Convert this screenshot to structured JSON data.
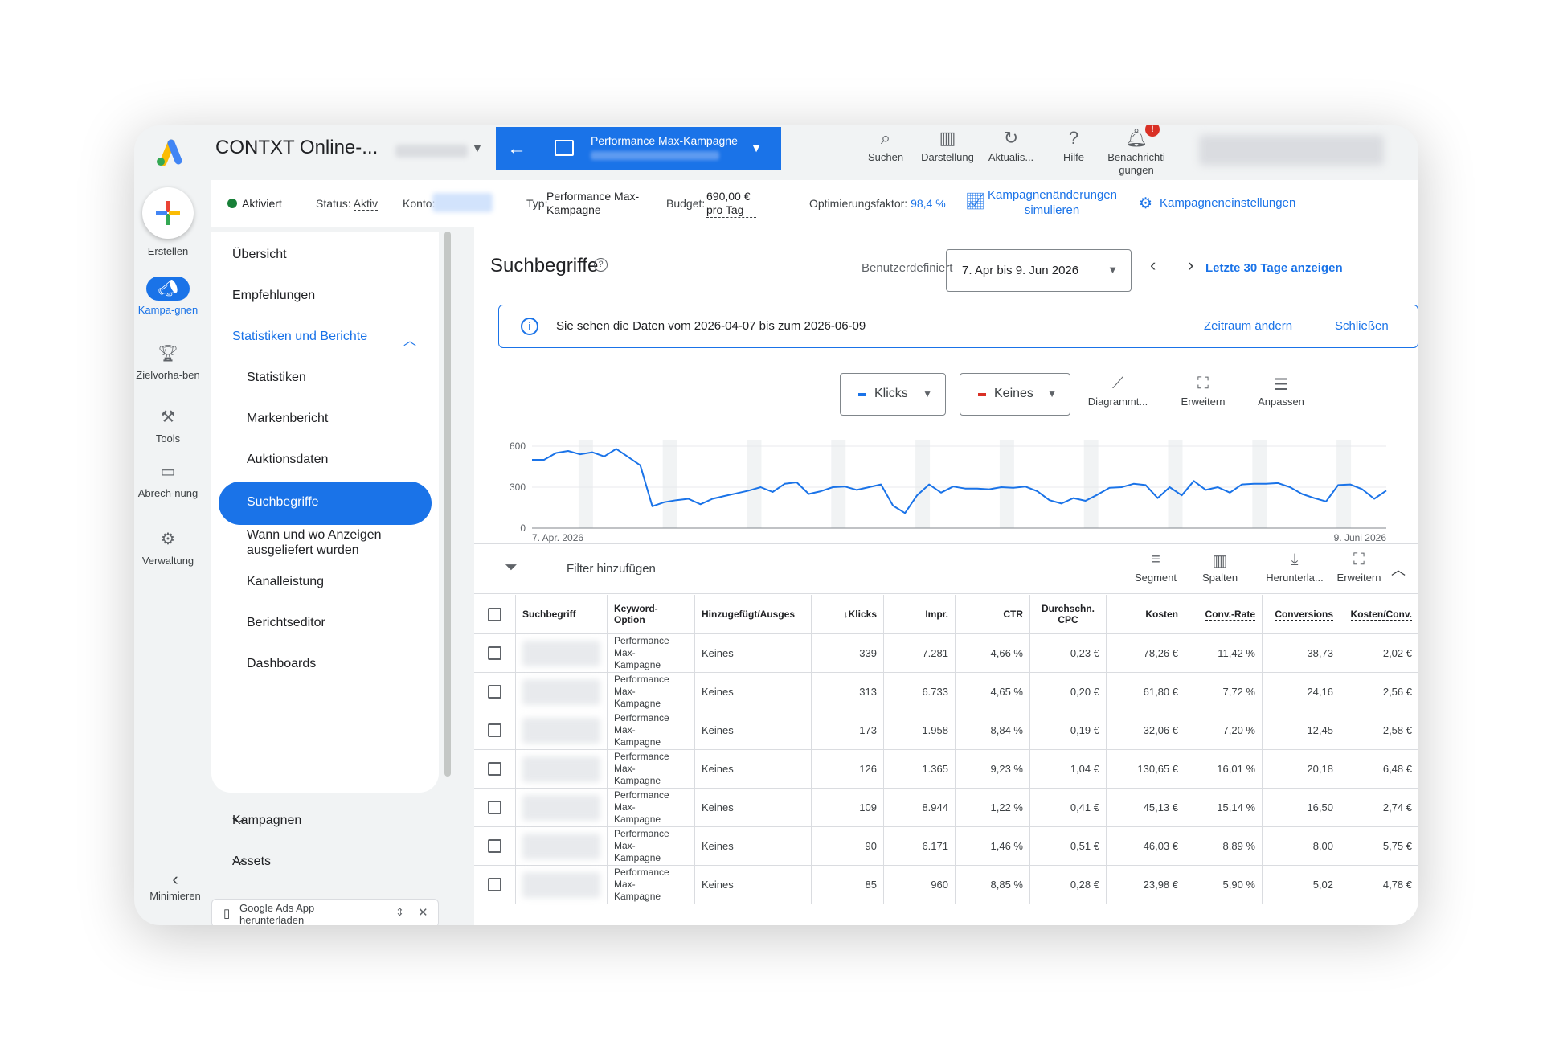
{
  "topbar": {
    "account_title": "CONTXT Online-...",
    "campaign_type_label": "Performance Max-Kampagne",
    "tools": [
      {
        "icon": "search-icon",
        "label": "Suchen"
      },
      {
        "icon": "display-icon",
        "label": "Darstellung"
      },
      {
        "icon": "refresh-icon",
        "label": "Aktualis..."
      },
      {
        "icon": "help-icon",
        "label": "Hilfe"
      },
      {
        "icon": "bell-icon",
        "label": "Benachrichti gungen"
      }
    ],
    "notification_badge": "!"
  },
  "rail": {
    "create_label": "Erstellen",
    "items": [
      {
        "icon": "megaphone-icon",
        "label": "Kampa-gnen",
        "active": true
      },
      {
        "icon": "trophy-icon",
        "label": "Zielvorha-ben"
      },
      {
        "icon": "tools-icon",
        "label": "Tools"
      },
      {
        "icon": "card-icon",
        "label": "Abrech-nung"
      },
      {
        "icon": "gear-icon",
        "label": "Verwaltung"
      }
    ],
    "minimize_label": "Minimieren"
  },
  "statusbar": {
    "activated": "Aktiviert",
    "status_label": "Status:",
    "status_value": "Aktiv",
    "account_label": "Konto:",
    "type_label": "Typ:",
    "type_value": "Performance Max-Kampagne",
    "budget_label": "Budget:",
    "budget_value": "690,00 € pro Tag",
    "opt_label": "Optimierungsfaktor:",
    "opt_value": "98,4 %",
    "simulate": "Kampagnenänderungen simulieren",
    "settings": "Kampagneneinstellungen"
  },
  "nav": {
    "items": [
      "Übersicht",
      "Empfehlungen"
    ],
    "section": "Statistiken und Berichte",
    "sub_items": [
      "Statistiken",
      "Markenbericht",
      "Auktionsdaten",
      "Suchbegriffe",
      "Wann und wo Anzeigen ausgeliefert wurden",
      "Kanalleistung",
      "Berichtseditor",
      "Dashboards"
    ],
    "collapsed": [
      "Kampagnen",
      "Assets"
    ],
    "app_banner": "Google Ads App herunterladen"
  },
  "main": {
    "title": "Suchbegriffe",
    "date_mode": "Benutzerdefiniert",
    "date_range": "7. Apr bis 9. Jun 2026",
    "last30": "Letzte 30 Tage anzeigen",
    "info_text": "Sie sehen die Daten vom 2026-04-07 bis zum 2026-06-09",
    "info_change": "Zeitraum ändern",
    "info_close": "Schließen",
    "metric1": "Klicks",
    "metric2": "Keines",
    "chart_tools": [
      "Diagrammt...",
      "Erweitern",
      "Anpassen"
    ],
    "filter": "Filter hinzufügen",
    "table_tools": [
      "Segment",
      "Spalten",
      "Herunterla...",
      "Erweitern"
    ]
  },
  "colors": {
    "accent": "#1a73e8",
    "metric1": "#1a73e8",
    "metric2": "#d93025",
    "status_green": "#188038"
  },
  "chart_data": {
    "type": "line",
    "series": [
      {
        "name": "Klicks",
        "values": [
          500,
          500,
          550,
          565,
          540,
          555,
          525,
          580,
          520,
          460,
          160,
          190,
          205,
          215,
          175,
          215,
          235,
          255,
          275,
          300,
          265,
          325,
          335,
          250,
          270,
          300,
          305,
          280,
          300,
          320,
          165,
          110,
          240,
          320,
          260,
          305,
          290,
          290,
          285,
          300,
          295,
          305,
          270,
          205,
          180,
          220,
          200,
          245,
          295,
          300,
          325,
          315,
          220,
          300,
          240,
          345,
          280,
          300,
          260,
          320,
          325,
          325,
          330,
          300,
          250,
          220,
          195,
          315,
          320,
          285,
          215,
          275
        ]
      }
    ],
    "ylim": [
      0,
      600
    ],
    "yticks": [
      "600",
      "300",
      "0"
    ],
    "x_start_label": "7. Apr. 2026",
    "x_end_label": "9. Juni 2026",
    "grid": true
  },
  "table": {
    "headers": [
      "Suchbegriff",
      "Keyword-Option",
      "Hinzugefügt/Ausges",
      "Klicks",
      "Impr.",
      "CTR",
      "Durchschn. CPC",
      "Kosten",
      "Conv.-Rate",
      "Conversions",
      "Kosten/Conv."
    ],
    "rows": [
      {
        "option": "Performance Max-Kampagne",
        "added": "Keines",
        "clicks": "339",
        "impr": "7.281",
        "ctr": "4,66 %",
        "cpc": "0,23 €",
        "cost": "78,26 €",
        "convrate": "11,42 %",
        "conv": "38,73",
        "costconv": "2,02 €"
      },
      {
        "option": "Performance Max-Kampagne",
        "added": "Keines",
        "clicks": "313",
        "impr": "6.733",
        "ctr": "4,65 %",
        "cpc": "0,20 €",
        "cost": "61,80 €",
        "convrate": "7,72 %",
        "conv": "24,16",
        "costconv": "2,56 €"
      },
      {
        "option": "Performance Max-Kampagne",
        "added": "Keines",
        "clicks": "173",
        "impr": "1.958",
        "ctr": "8,84 %",
        "cpc": "0,19 €",
        "cost": "32,06 €",
        "convrate": "7,20 %",
        "conv": "12,45",
        "costconv": "2,58 €"
      },
      {
        "option": "Performance Max-Kampagne",
        "added": "Keines",
        "clicks": "126",
        "impr": "1.365",
        "ctr": "9,23 %",
        "cpc": "1,04 €",
        "cost": "130,65 €",
        "convrate": "16,01 %",
        "conv": "20,18",
        "costconv": "6,48 €"
      },
      {
        "option": "Performance Max-Kampagne",
        "added": "Keines",
        "clicks": "109",
        "impr": "8.944",
        "ctr": "1,22 %",
        "cpc": "0,41 €",
        "cost": "45,13 €",
        "convrate": "15,14 %",
        "conv": "16,50",
        "costconv": "2,74 €"
      },
      {
        "option": "Performance Max-Kampagne",
        "added": "Keines",
        "clicks": "90",
        "impr": "6.171",
        "ctr": "1,46 %",
        "cpc": "0,51 €",
        "cost": "46,03 €",
        "convrate": "8,89 %",
        "conv": "8,00",
        "costconv": "5,75 €"
      },
      {
        "option": "Performance Max-Kampagne",
        "added": "Keines",
        "clicks": "85",
        "impr": "960",
        "ctr": "8,85 %",
        "cpc": "0,28 €",
        "cost": "23,98 €",
        "convrate": "5,90 %",
        "conv": "5,02",
        "costconv": "4,78 €"
      }
    ]
  }
}
